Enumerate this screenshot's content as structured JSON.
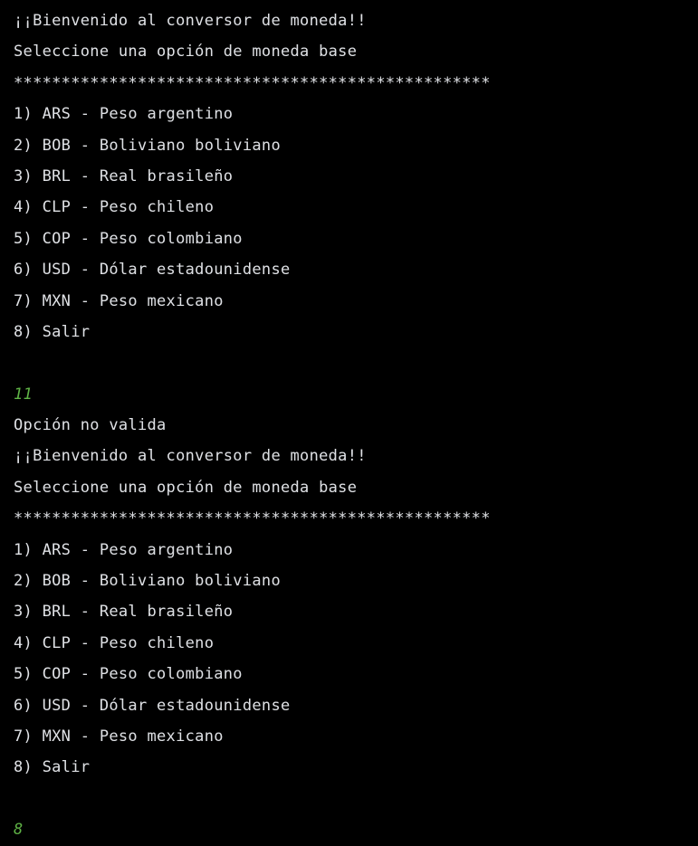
{
  "colors": {
    "background": "#000000",
    "output_text": "#dfe1e5",
    "user_input": "#5fb346"
  },
  "console": {
    "block1": {
      "welcome": "¡¡Bienvenido al conversor de moneda!!",
      "prompt": "Seleccione una opción de moneda base",
      "separator": "**************************************************",
      "options": [
        "1) ARS - Peso argentino",
        "2) BOB - Boliviano boliviano",
        "3) BRL - Real brasileño",
        "4) CLP - Peso chileno",
        "5) COP - Peso colombiano",
        "6) USD - Dólar estadounidense",
        "7) MXN - Peso mexicano",
        "8) Salir"
      ],
      "user_input": "11",
      "response": "Opción no valida"
    },
    "block2": {
      "welcome": "¡¡Bienvenido al conversor de moneda!!",
      "prompt": "Seleccione una opción de moneda base",
      "separator": "**************************************************",
      "options": [
        "1) ARS - Peso argentino",
        "2) BOB - Boliviano boliviano",
        "3) BRL - Real brasileño",
        "4) CLP - Peso chileno",
        "5) COP - Peso colombiano",
        "6) USD - Dólar estadounidense",
        "7) MXN - Peso mexicano",
        "8) Salir"
      ],
      "user_input": "8"
    }
  }
}
